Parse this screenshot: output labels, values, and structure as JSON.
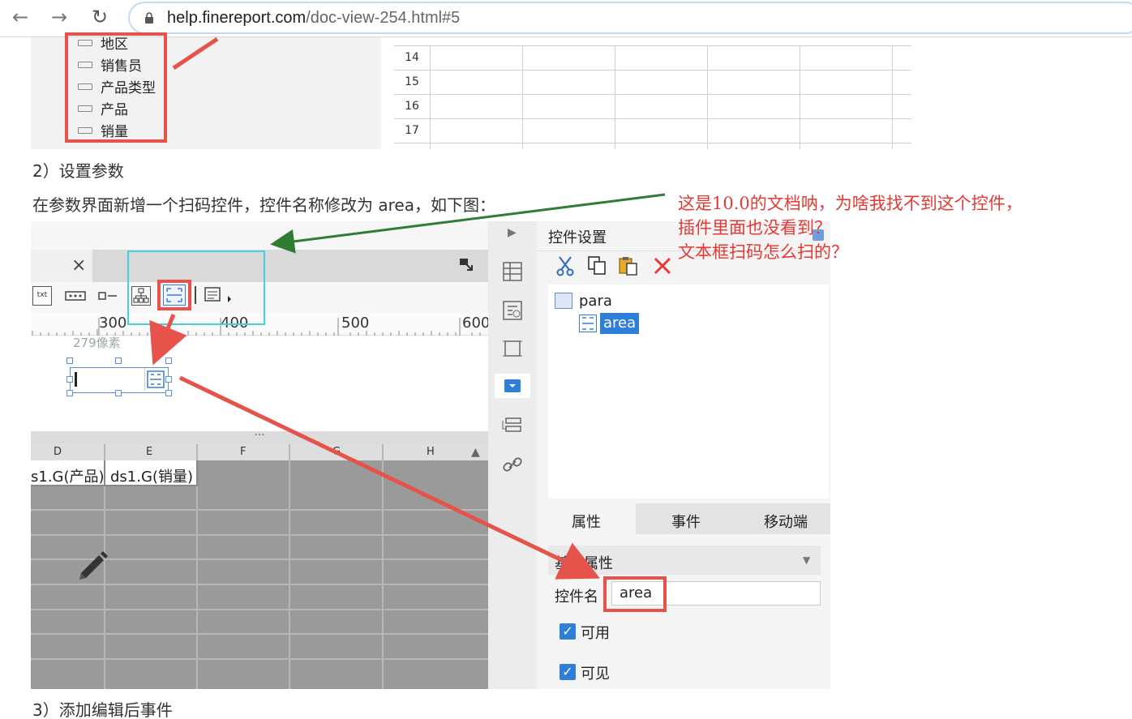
{
  "browser": {
    "url_host": "help.finereport.com",
    "url_path": "/doc-view-254.html#5"
  },
  "top_snippet": {
    "fields": [
      "地区",
      "销售员",
      "产品类型",
      "产品",
      "销量"
    ],
    "row_numbers": [
      "14",
      "15",
      "16",
      "17"
    ]
  },
  "doc": {
    "heading_2": "2）设置参数",
    "paragraph": "在参数界面新增一个扫码控件，控件名称修改为 area，如下图：",
    "heading_3": "3）添加编辑后事件"
  },
  "designer": {
    "close_tab": "×",
    "toolbar_txt": "txt",
    "ruler_marks": [
      "300",
      "400",
      "500",
      "600"
    ],
    "pixel_label": "279像素",
    "splitter": "···",
    "column_headers": [
      "D",
      "E",
      "F",
      "G",
      "H"
    ],
    "cells": [
      "s1.G(产品)",
      "ds1.G(销量)"
    ]
  },
  "settings": {
    "title": "控件设置",
    "tree_root": "para",
    "tree_child": "area",
    "tabs": [
      "属性",
      "事件",
      "移动端"
    ],
    "section": "基本属性",
    "name_label": "控件名",
    "name_value": "area",
    "checkboxes": [
      "可用",
      "可见"
    ]
  },
  "annotation": {
    "lines": [
      "这是10.0的文档呐，为啥我找不到这个控件，",
      "插件里面也没看到？",
      "文本框扫码怎么扫的？"
    ]
  },
  "colors": {
    "highlight_red": "#e5534b",
    "cyan_box": "#3ed3dd",
    "green_arrow": "#2e7d32",
    "selection_blue": "#2f7fd8",
    "annotation_red": "#e53935"
  }
}
